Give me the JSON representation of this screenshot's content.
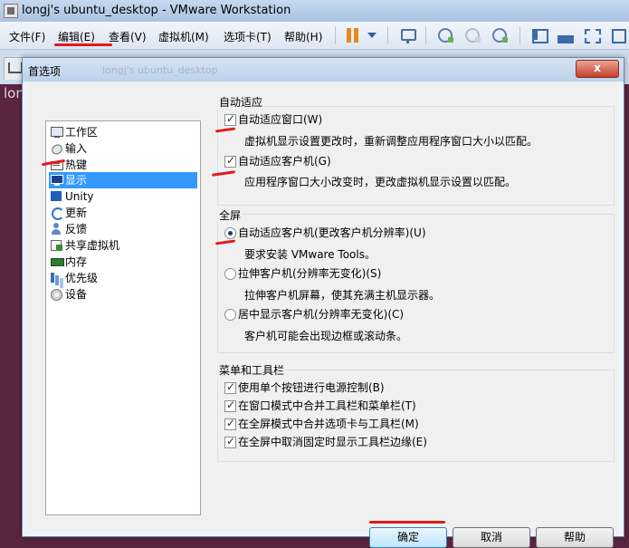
{
  "window": {
    "title": "longj's ubuntu_desktop - VMware Workstation"
  },
  "menubar": {
    "items": [
      "文件(F)",
      "编辑(E)",
      "查看(V)",
      "虚拟机(M)",
      "选项卡(T)",
      "帮助(H)"
    ]
  },
  "toolbar": {
    "icons": [
      "pause-icon",
      "dropdown-icon",
      "network-icon",
      "snapshot-icon",
      "revert-snapshot-icon",
      "snapshot-manager-icon",
      "library-icon",
      "console-view-icon",
      "full-screen-icon",
      "unity-view-icon"
    ]
  },
  "vm": {
    "console_text": "lon"
  },
  "dialog": {
    "title": "首选项",
    "ghost_title": "longj's ubuntu_desktop",
    "close_label": "x",
    "nav": [
      {
        "label": "工作区",
        "icon": "workspace-icon",
        "selected": false
      },
      {
        "label": "输入",
        "icon": "input-icon",
        "selected": false
      },
      {
        "label": "热键",
        "icon": "hotkeys-icon",
        "selected": false
      },
      {
        "label": "显示",
        "icon": "display-icon",
        "selected": true
      },
      {
        "label": "Unity",
        "icon": "unity-icon",
        "selected": false
      },
      {
        "label": "更新",
        "icon": "update-icon",
        "selected": false
      },
      {
        "label": "反馈",
        "icon": "feedback-icon",
        "selected": false
      },
      {
        "label": "共享虚拟机",
        "icon": "shared-vm-icon",
        "selected": false
      },
      {
        "label": "内存",
        "icon": "memory-icon",
        "selected": false
      },
      {
        "label": "优先级",
        "icon": "priority-icon",
        "selected": false
      },
      {
        "label": "设备",
        "icon": "devices-icon",
        "selected": false
      }
    ],
    "autofit": {
      "title": "自动适应",
      "window_opt": "自动适应窗口(W)",
      "window_checked": true,
      "window_desc": "虚拟机显示设置更改时，重新调整应用程序窗口大小以匹配。",
      "guest_opt": "自动适应客户机(G)",
      "guest_checked": true,
      "guest_desc": "应用程序窗口大小改变时，更改虚拟机显示设置以匹配。"
    },
    "fullscreen": {
      "title": "全屏",
      "selected": "autofit_guest",
      "opt1": "自动适应客户机(更改客户机分辨率)(U)",
      "opt1_desc": "要求安装 VMware Tools。",
      "opt2": "拉伸客户机(分辨率无变化)(S)",
      "opt2_desc": "拉伸客户机屏幕，使其充满主机显示器。",
      "opt3": "居中显示客户机(分辨率无变化)(C)",
      "opt3_desc": "客户机可能会出现边框或滚动条。"
    },
    "menus": {
      "title": "菜单和工具栏",
      "items": [
        {
          "label": "使用单个按钮进行电源控制(B)",
          "checked": true
        },
        {
          "label": "在窗口模式中合并工具栏和菜单栏(T)",
          "checked": true
        },
        {
          "label": "在全屏模式中合并选项卡与工具栏(M)",
          "checked": true
        },
        {
          "label": "在全屏中取消固定时显示工具栏边缘(E)",
          "checked": true
        }
      ]
    },
    "buttons": {
      "ok": "确定",
      "cancel": "取消",
      "help": "帮助"
    }
  },
  "annotation_color": "#e21a1a"
}
